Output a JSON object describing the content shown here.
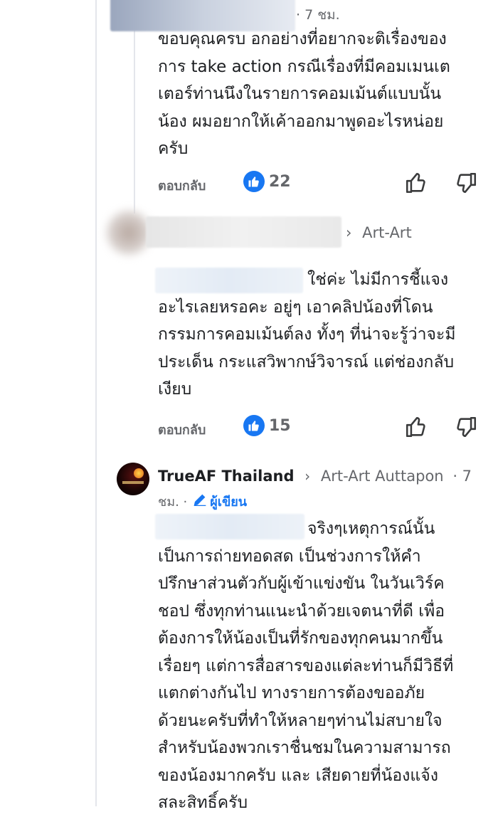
{
  "comments": [
    {
      "time": "· 7 ชม.",
      "body": "ขอบคุณครบ อกอย่างที่อยากจะติเรื่องของ\nการ take action กรณีเรื่องที่มีคอมเมนเต\nเตอร์ท่านนึงในรายการคอมเม้นต์แบบนั้น\nน้อง ผมอยากให้เค้าออกมาพูดอะไรหน่อย\nครับ",
      "reply_label": "ตอบกลับ",
      "likes": "22"
    },
    {
      "reply_to": "Art-Art",
      "body": "ใช่ค่ะ ไม่มีการชี้แจง\nอะไรเลยหรอคะ อยู่ๆ เอาคลิปน้องที่โดน\nกรรมการคอมเม้นต์ลง ทั้งๆ ที่น่าจะรู้ว่าจะมี\nประเด็น กระแสวิพากษ์วิจารณ์ แต่ช่องกลับ\nเงียบ",
      "reply_label": "ตอบกลับ",
      "likes": "15"
    },
    {
      "author": "TrueAF Thailand",
      "reply_to": "Art-Art Auttapon",
      "time_a": "· 7",
      "time_b": "ชม. ·",
      "badge": "ผู้เขียน",
      "body": "จริงๆเหตุการณ์นั้น\nเป็นการถ่ายทอดสด เป็นช่วงการให้คำ\nปรึกษาส่วนตัวกับผู้เข้าแข่งขัน ในวันเวิร์ค\nชอป ซึ่งทุกท่านแนะนำด้วยเจตนาที่ดี เพื่อ\nต้องการให้น้องเป็นที่รักของทุกคนมากขึ้น\nเรื่อยๆ แต่การสื่อสารของแต่ละท่านก็มีวิธีที่\nแตกต่างกันไป ทางรายการต้องขออภัย\nด้วยนะครับที่ทำให้หลายๆท่านไม่สบายใจ\nสำหรับน้องพวกเราชื่นชมในความสามารถ\nของน้องมากครับ และ เสียดายที่น้องแจ้ง\nสละสิทธิ์ครับ"
    }
  ],
  "colors": {
    "accent": "#1877f2",
    "muted": "#65676b",
    "text": "#1c1e21",
    "line": "#e4e6eb"
  },
  "icons": [
    "like-reaction-icon",
    "thumbs-up-icon",
    "thumbs-down-icon",
    "pencil-icon",
    "chevron-right-icon"
  ]
}
